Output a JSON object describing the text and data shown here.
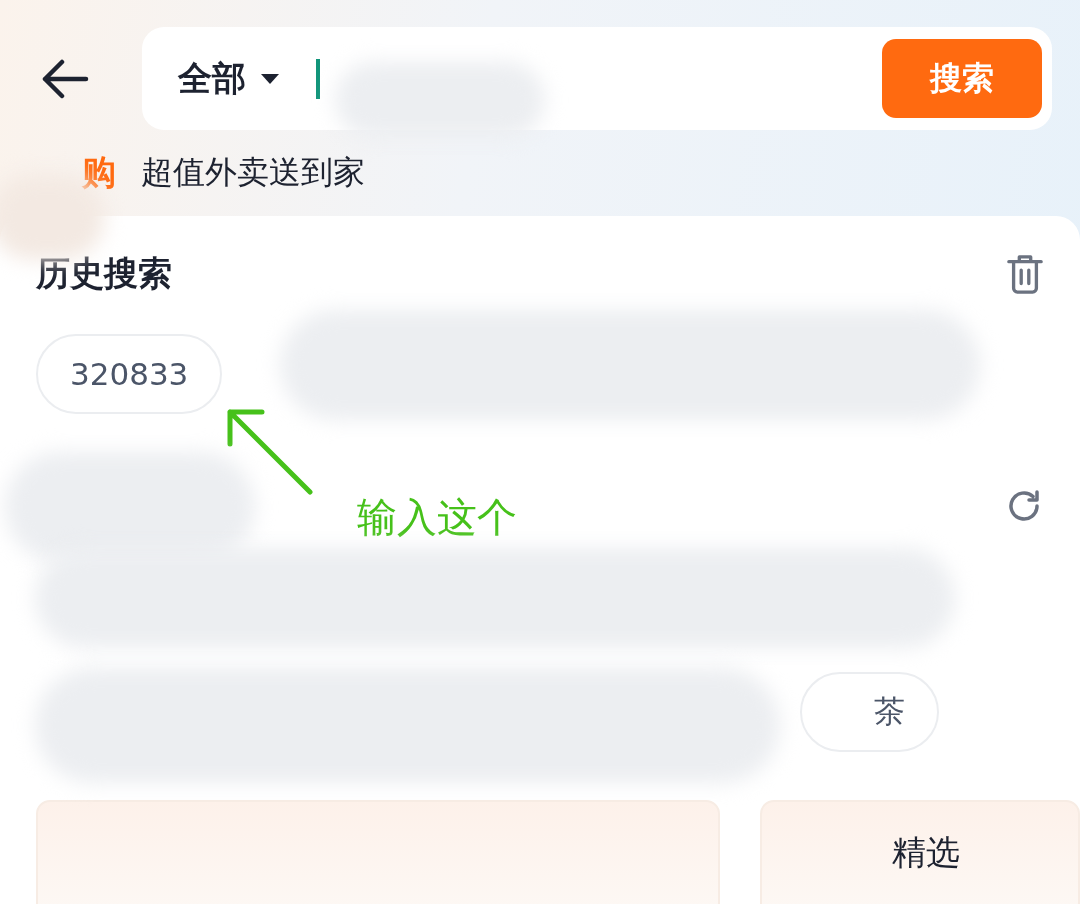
{
  "search_bar": {
    "scope": "全部",
    "button": "搜索"
  },
  "promo": {
    "badge": "购",
    "text": "超值外卖送到家"
  },
  "history": {
    "title": "历史搜索",
    "chips": [
      {
        "text": "320833"
      }
    ]
  },
  "annotation": {
    "text": "输入这个"
  },
  "suggestions": {
    "chips": [
      {
        "text": "茶"
      }
    ]
  },
  "cards": [
    {
      "kind": "plain"
    },
    {
      "kind": "titled",
      "title": "精选"
    }
  ]
}
